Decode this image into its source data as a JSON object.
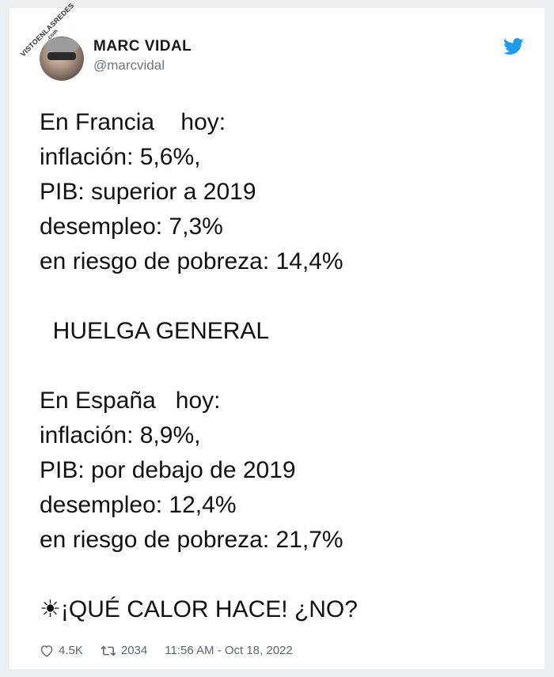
{
  "watermark": {
    "main": "VISTOENLASREDES",
    "sub": ".com"
  },
  "user": {
    "display_name": "MARC VIDAL",
    "handle": "@marcvidal"
  },
  "tweet": {
    "lines": [
      "En Francia    hoy:",
      "inflación: 5,6%,",
      "PIB: superior a 2019",
      "desempleo: 7,3%",
      "en riesgo de pobreza: 14,4%",
      "",
      "  HUELGA GENERAL",
      "",
      "En España   hoy:",
      "inflación: 8,9%,",
      "PIB: por debajo de 2019",
      "desempleo: 12,4%",
      "en riesgo de pobreza: 21,7%",
      "",
      "☀¡QUÉ CALOR HACE! ¿NO?"
    ]
  },
  "footer": {
    "likes": "4.5K",
    "retweets": "2034",
    "timestamp": "11:56 AM - Oct 18, 2022"
  },
  "icons": {
    "like": "heart-icon",
    "retweet": "retweet-icon",
    "brand": "twitter-bird-icon"
  },
  "colors": {
    "twitter_blue": "#1d9bf0",
    "muted_text": "#5b6670"
  }
}
